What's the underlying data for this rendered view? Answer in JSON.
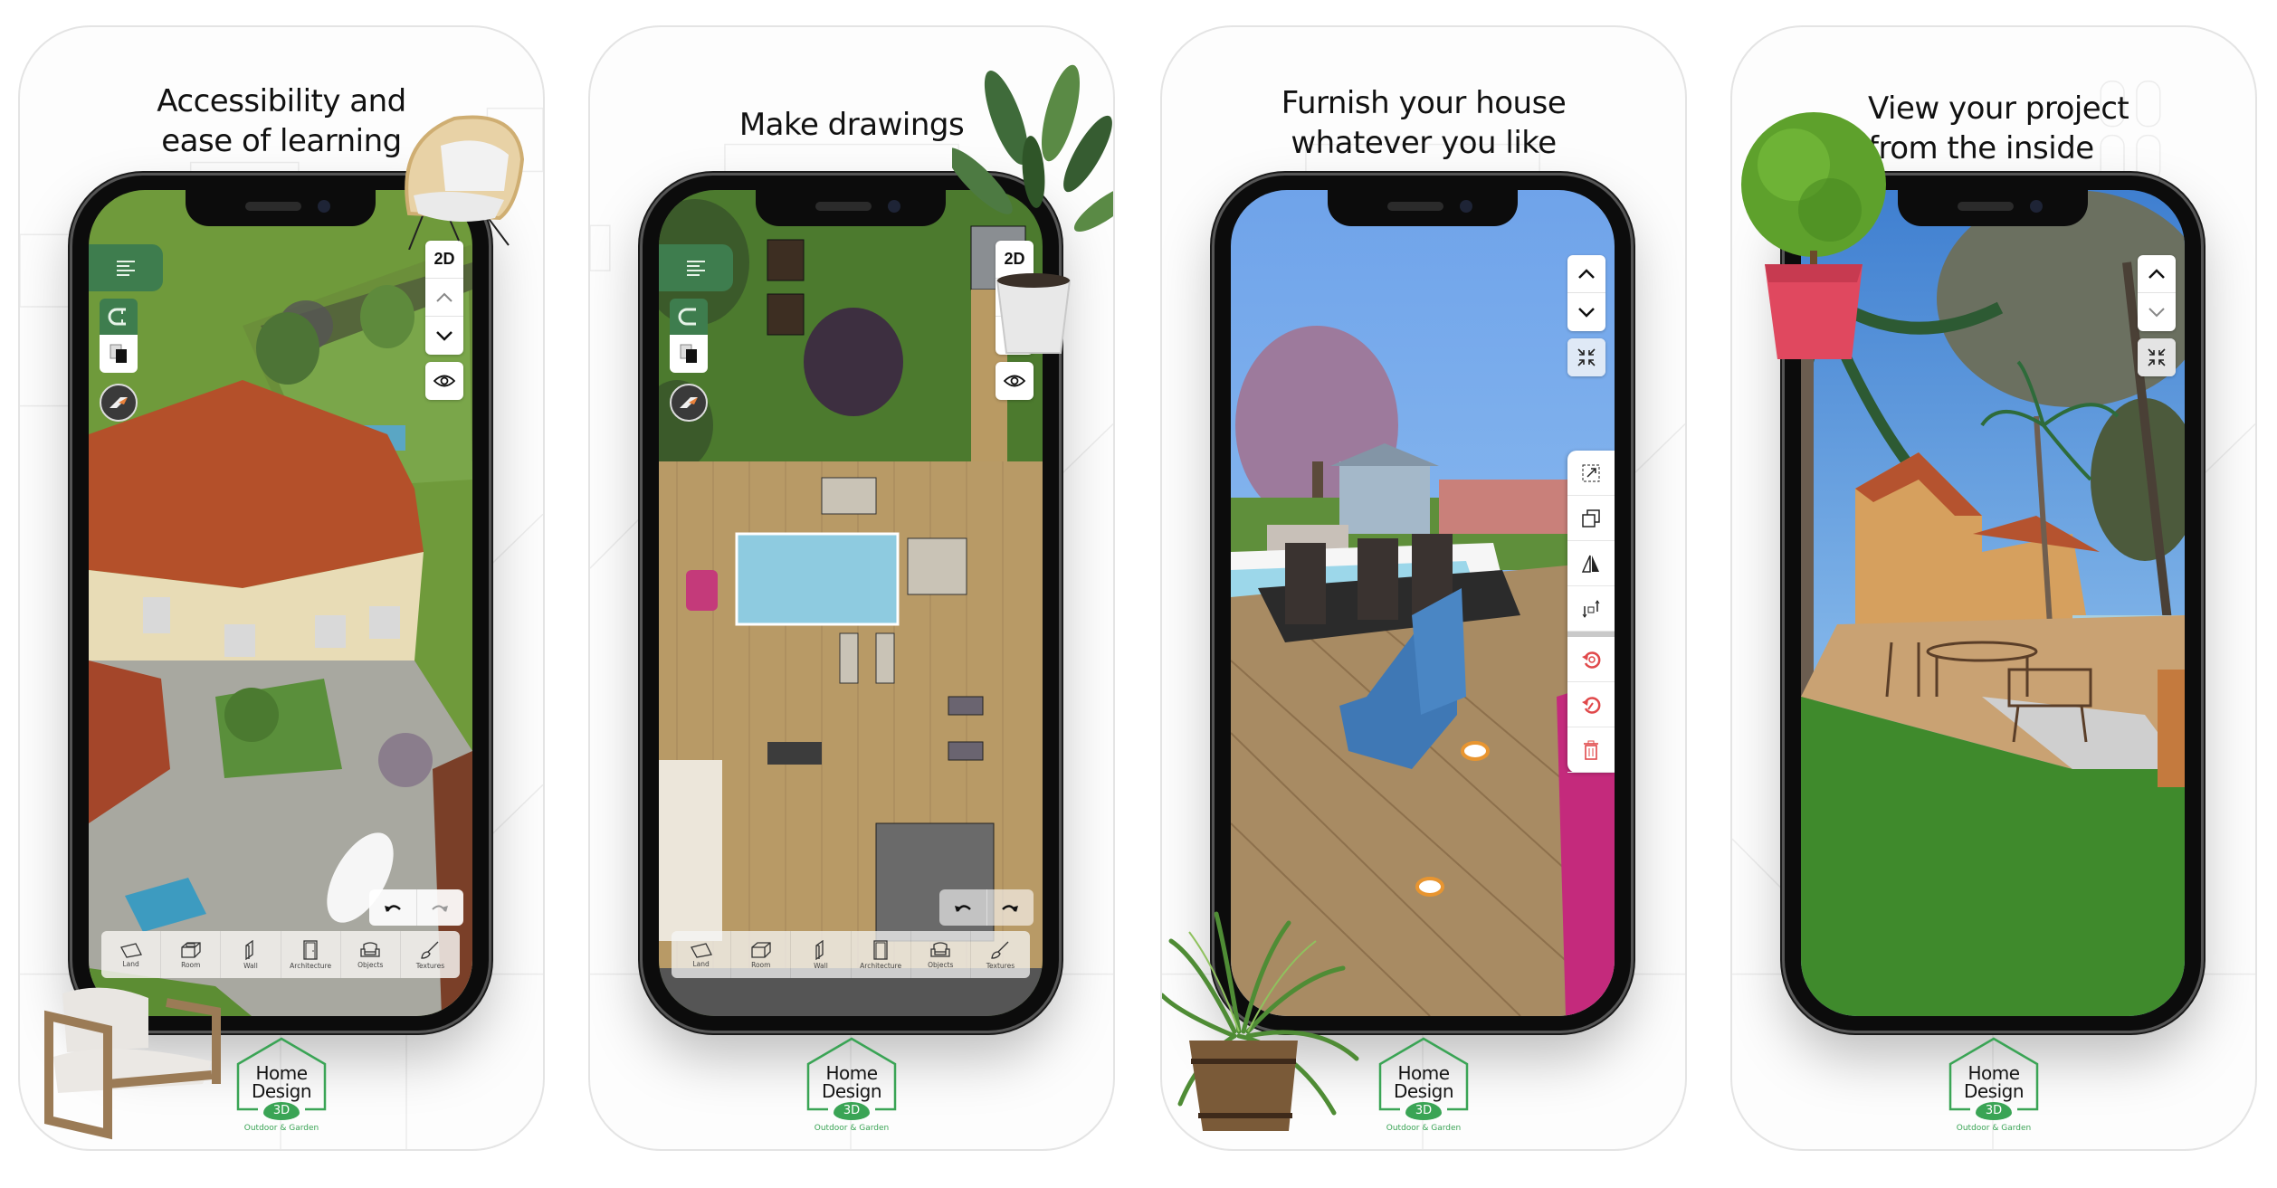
{
  "app": {
    "name": "Home Design 3D",
    "logo": {
      "line1": "Home",
      "line2": "Design",
      "badge": "3D",
      "subtitle": "Outdoor & Garden"
    },
    "colors": {
      "brand_green": "#3e7d4e",
      "logo_green": "#3aa455",
      "accent_red": "#e0484a"
    }
  },
  "toolbar": {
    "menu_icon": "menu-lines-icon",
    "view_toggle_label": "2D",
    "bottom_items": [
      {
        "label": "Land",
        "icon": "land-icon"
      },
      {
        "label": "Room",
        "icon": "room-icon"
      },
      {
        "label": "Wall",
        "icon": "wall-icon"
      },
      {
        "label": "Architecture",
        "icon": "door-icon"
      },
      {
        "label": "Objects",
        "icon": "armchair-icon"
      },
      {
        "label": "Textures",
        "icon": "brush-icon"
      }
    ],
    "object_tools": [
      "resize-icon",
      "duplicate-icon",
      "mirror-icon",
      "elevation-icon",
      "rotate-icon",
      "reset-rotation-icon",
      "trash-icon"
    ]
  },
  "panels": [
    {
      "title": "Accessibility and\nease of learning",
      "view": "3D aerial view"
    },
    {
      "title": "Make drawings",
      "view": "2D plan view"
    },
    {
      "title": "Furnish your house\nwhatever you like",
      "view": "3D object editing"
    },
    {
      "title": "View your project\nfrom the inside",
      "view": "3D walk-through"
    }
  ]
}
